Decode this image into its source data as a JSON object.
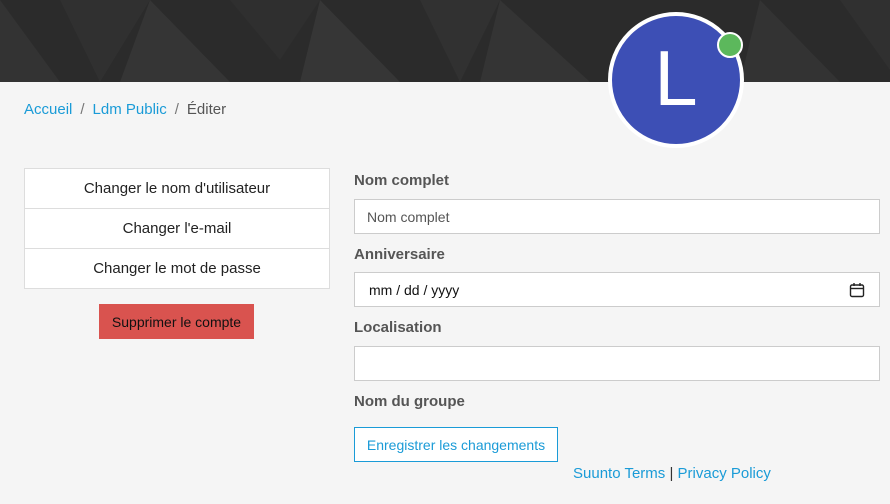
{
  "avatar": {
    "letter": "L",
    "color": "#3d4fb5",
    "status_color": "#5cb85c"
  },
  "breadcrumb": {
    "items": [
      {
        "label": "Accueil"
      },
      {
        "label": "Ldm Public"
      }
    ],
    "current": "Éditer",
    "separator": "/"
  },
  "side_menu": {
    "items": [
      {
        "label": "Changer le nom d'utilisateur"
      },
      {
        "label": "Changer l'e-mail"
      },
      {
        "label": "Changer le mot de passe"
      }
    ],
    "delete_label": "Supprimer le compte"
  },
  "form": {
    "full_name": {
      "label": "Nom complet",
      "placeholder": "Nom complet",
      "value": ""
    },
    "birthday": {
      "label": "Anniversaire",
      "value": "mm / dd / yyyy"
    },
    "location": {
      "label": "Localisation",
      "value": ""
    },
    "group_name": {
      "label": "Nom du groupe"
    },
    "save_label": "Enregistrer les changements"
  },
  "footer": {
    "terms_label": "Suunto Terms",
    "separator": "|",
    "privacy_label": "Privacy Policy"
  },
  "colors": {
    "accent": "#1a9bd7",
    "danger": "#d9534f",
    "banner": "#2b2b2b"
  }
}
